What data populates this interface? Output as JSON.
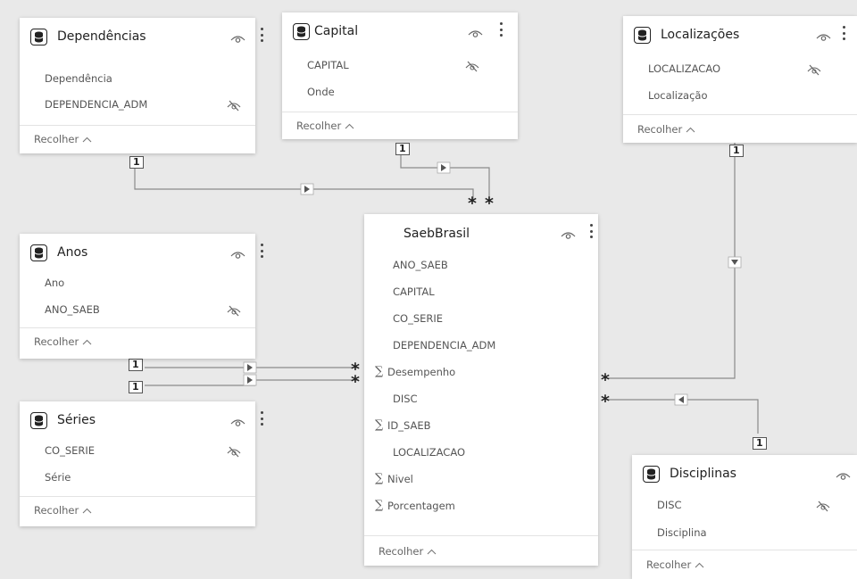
{
  "tables": {
    "dependencias": {
      "title": "Dependências",
      "fields": [
        {
          "name": "Dependência",
          "hidden": false,
          "sum": false
        },
        {
          "name": "DEPENDENCIA_ADM",
          "hidden": true,
          "sum": false
        }
      ],
      "collapse_label": "Recolher"
    },
    "capital": {
      "title": "Capital",
      "fields": [
        {
          "name": "CAPITAL",
          "hidden": true,
          "sum": false
        },
        {
          "name": "Onde",
          "hidden": false,
          "sum": false
        }
      ],
      "collapse_label": "Recolher"
    },
    "localizacoes": {
      "title": "Localizações",
      "fields": [
        {
          "name": "LOCALIZACAO",
          "hidden": true,
          "sum": false
        },
        {
          "name": "Localização",
          "hidden": false,
          "sum": false
        }
      ],
      "collapse_label": "Recolher"
    },
    "anos": {
      "title": "Anos",
      "fields": [
        {
          "name": "Ano",
          "hidden": false,
          "sum": false
        },
        {
          "name": "ANO_SAEB",
          "hidden": true,
          "sum": false
        }
      ],
      "collapse_label": "Recolher"
    },
    "series": {
      "title": "Séries",
      "fields": [
        {
          "name": "CO_SERIE",
          "hidden": true,
          "sum": false
        },
        {
          "name": "Série",
          "hidden": false,
          "sum": false
        }
      ],
      "collapse_label": "Recolher"
    },
    "saebbrasil": {
      "title": "SaebBrasil",
      "fields": [
        {
          "name": "ANO_SAEB",
          "hidden": false,
          "sum": false
        },
        {
          "name": "CAPITAL",
          "hidden": false,
          "sum": false
        },
        {
          "name": "CO_SERIE",
          "hidden": false,
          "sum": false
        },
        {
          "name": "DEPENDENCIA_ADM",
          "hidden": false,
          "sum": false
        },
        {
          "name": "Desempenho",
          "hidden": false,
          "sum": true
        },
        {
          "name": "DISC",
          "hidden": false,
          "sum": false
        },
        {
          "name": "ID_SAEB",
          "hidden": false,
          "sum": true
        },
        {
          "name": "LOCALIZACAO",
          "hidden": false,
          "sum": false
        },
        {
          "name": "Nivel",
          "hidden": false,
          "sum": true
        },
        {
          "name": "Porcentagem",
          "hidden": false,
          "sum": true
        }
      ],
      "collapse_label": "Recolher"
    },
    "disciplinas": {
      "title": "Disciplinas",
      "fields": [
        {
          "name": "DISC",
          "hidden": true,
          "sum": false
        },
        {
          "name": "Disciplina",
          "hidden": false,
          "sum": false
        }
      ],
      "collapse_label": "Recolher"
    }
  },
  "relationships": [
    {
      "from": "dependencias",
      "to": "saebbrasil",
      "one_label": "1",
      "many_label": "*"
    },
    {
      "from": "capital",
      "to": "saebbrasil",
      "one_label": "1",
      "many_label": "*"
    },
    {
      "from": "localizacoes",
      "to": "saebbrasil",
      "one_label": "1",
      "many_label": "*"
    },
    {
      "from": "anos",
      "to": "saebbrasil",
      "one_label": "1",
      "many_label": "*"
    },
    {
      "from": "series",
      "to": "saebbrasil",
      "one_label": "1",
      "many_label": "*"
    },
    {
      "from": "disciplinas",
      "to": "saebbrasil",
      "one_label": "1",
      "many_label": "*"
    }
  ],
  "icons": {
    "table": "database-icon",
    "visibility": "eye-icon",
    "more": "more-options-icon",
    "hidden_field": "eye-off-icon",
    "collapse": "chevron-up-icon",
    "filter_direction": "triangle-arrow-icon"
  },
  "colors": {
    "canvas": "#e9e9e9",
    "card": "#ffffff",
    "line": "#8a8a8a"
  }
}
